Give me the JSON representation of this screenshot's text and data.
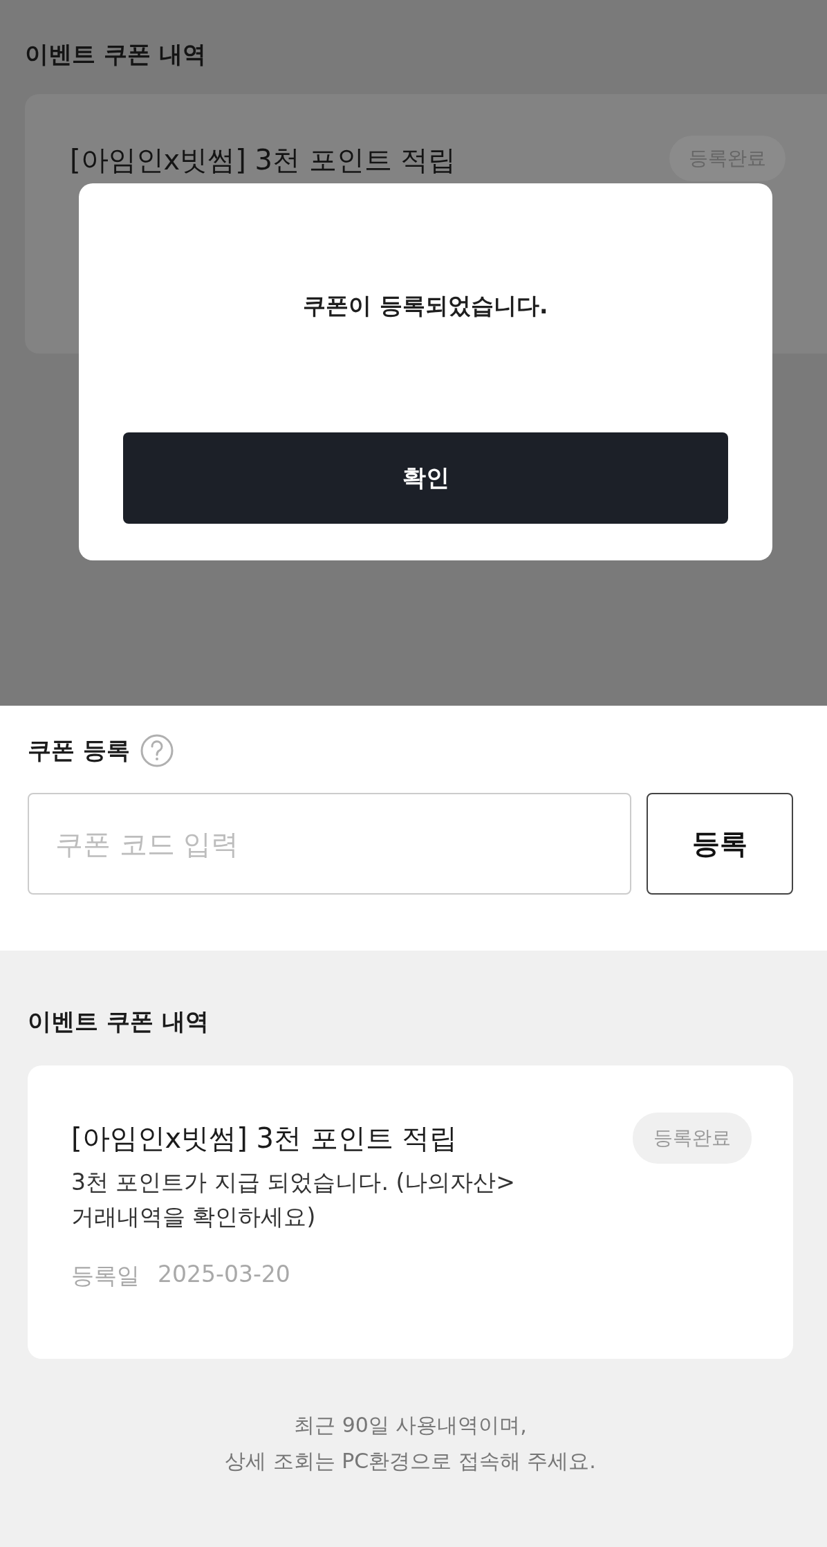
{
  "background_screen": {
    "heading": "이벤트 쿠폰 내역",
    "coupon": {
      "title": "[아임인x빗썸] 3천 포인트 적립",
      "status": "등록완료"
    }
  },
  "dialog": {
    "message": "쿠폰이 등록되었습니다.",
    "confirm_button": "확인"
  },
  "coupon_register": {
    "heading": "쿠폰 등록",
    "code_field": {
      "placeholder": "쿠폰 코드 입력"
    },
    "register_button": "등록"
  },
  "event_coupons": {
    "heading": "이벤트 쿠폰 내역",
    "items": [
      {
        "title": "[아임인x빗썸] 3천 포인트 적립",
        "status": "등록완료",
        "description": "3천 포인트가 지급 되었습니다. (나의자산>\n거래내역을 확인하세요)",
        "date_label": "등록일",
        "date": "2025-03-20"
      }
    ]
  },
  "footer_note": [
    "최근 90일 사용내역이며,",
    "상세 조회는 PC환경으로 접속해 주세요."
  ]
}
